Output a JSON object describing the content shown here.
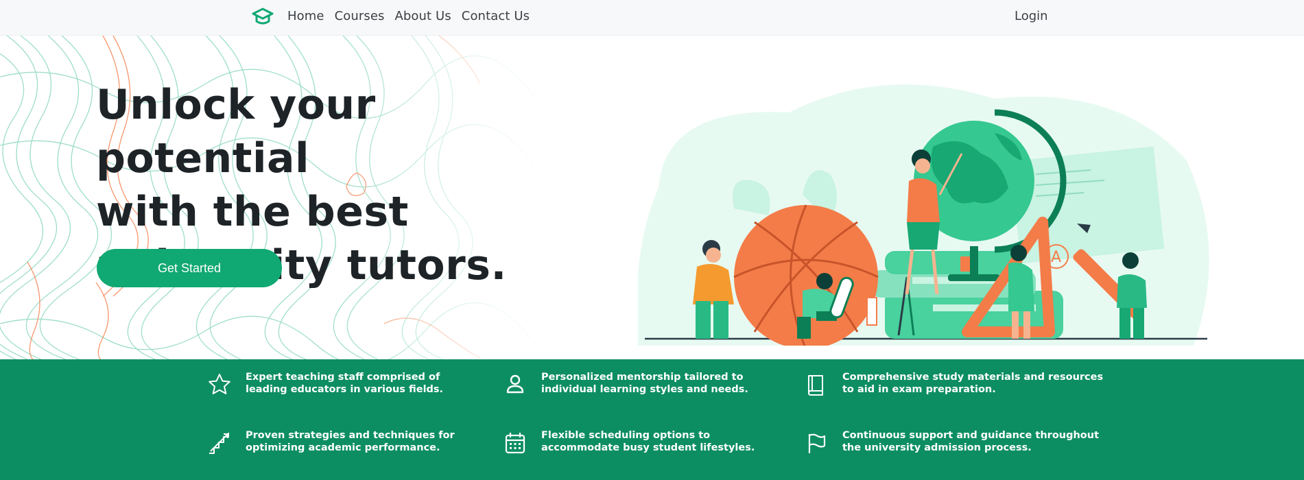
{
  "nav": {
    "brand_icon": "graduation-cap-icon",
    "links": [
      "Home",
      "Courses",
      "About Us",
      "Contact Us"
    ],
    "login": "Login"
  },
  "hero": {
    "title_lines": [
      "Unlock your potential",
      "with the best",
      "university tutors."
    ],
    "cta": "Get Started",
    "illustration": "tutoring-people-with-globe-basketball-books-illustration"
  },
  "features": [
    {
      "icon": "star-icon",
      "text": "Expert teaching staff comprised of leading educators in various fields."
    },
    {
      "icon": "person-icon",
      "text": "Personalized mentorship tailored to individual learning styles and needs."
    },
    {
      "icon": "book-icon",
      "text": "Comprehensive study materials and resources to aid in exam preparation."
    },
    {
      "icon": "stairs-progress-icon",
      "text": "Proven strategies and techniques for optimizing academic performance."
    },
    {
      "icon": "calendar-icon",
      "text": "Flexible scheduling options to accommodate busy student lifestyles."
    },
    {
      "icon": "flag-icon",
      "text": "Continuous support and guidance throughout the university admission process."
    }
  ],
  "colors": {
    "primary_green": "#10a873",
    "features_bg": "#0d8e62",
    "accent_orange": "#f47c48",
    "heading": "#1d2327"
  }
}
